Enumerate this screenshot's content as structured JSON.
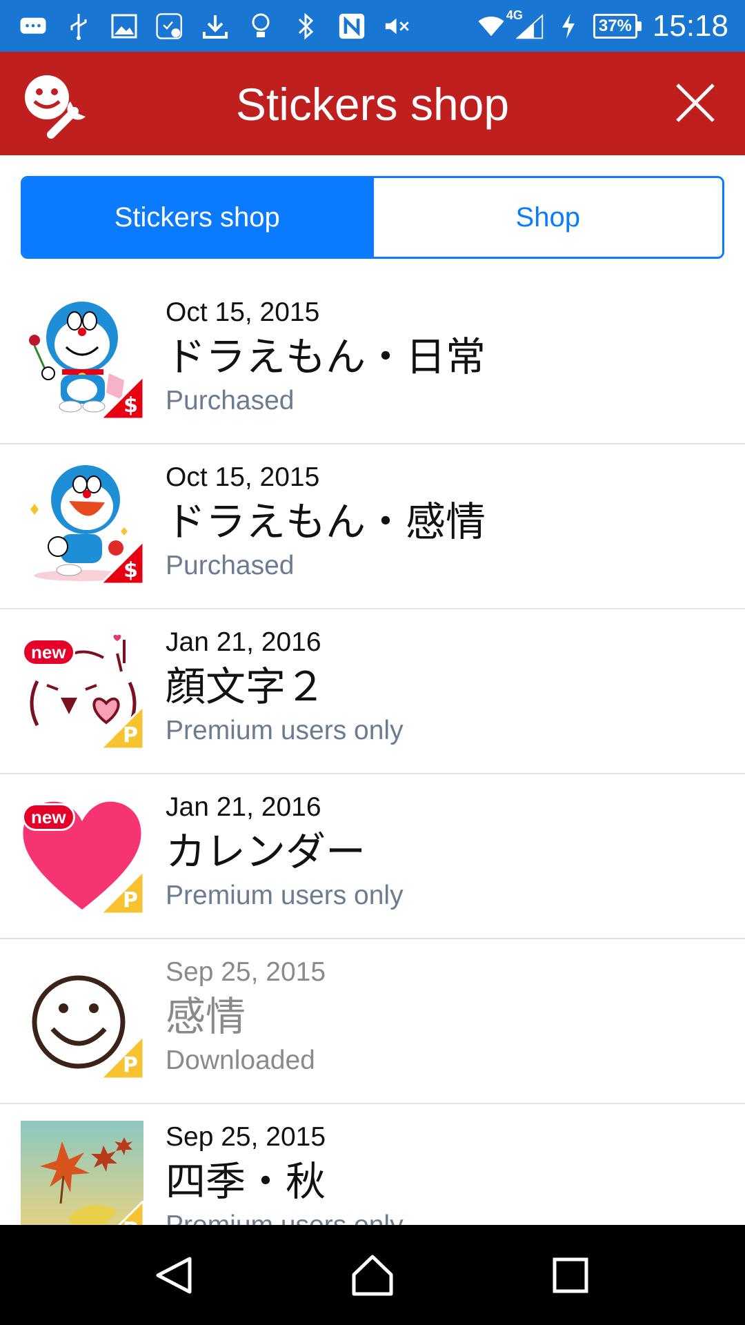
{
  "status_bar": {
    "time": "15:18",
    "battery": "37%",
    "network": "4G",
    "icons": [
      "chat-icon",
      "usb-icon",
      "image-icon",
      "app-check-icon",
      "download-icon",
      "bulb-icon",
      "bluetooth-icon",
      "nfc-icon",
      "mute-icon",
      "wifi-icon",
      "signal-icon",
      "charging-icon"
    ]
  },
  "header": {
    "title": "Stickers shop",
    "logo_icon": "smiley-wrench-icon",
    "close_icon": "close-icon",
    "color": "#bf1f1f"
  },
  "tabs": [
    {
      "label": "Stickers shop",
      "active": true
    },
    {
      "label": "Shop",
      "active": false
    }
  ],
  "items": [
    {
      "date": "Oct 15, 2015",
      "name": "ドラえもん・日常",
      "status": "Purchased",
      "badge": "$",
      "badge_type": "paid",
      "new": false,
      "thumb": "doraemon-daily"
    },
    {
      "date": "Oct 15, 2015",
      "name": "ドラえもん・感情",
      "status": "Purchased",
      "badge": "$",
      "badge_type": "paid",
      "new": false,
      "thumb": "doraemon-emotion"
    },
    {
      "date": "Jan 21, 2016",
      "name": "顔文字２",
      "status": "Premium users only",
      "badge": "P",
      "badge_type": "premium",
      "new": true,
      "new_label": "new",
      "thumb": "kaomoji"
    },
    {
      "date": "Jan 21, 2016",
      "name": "カレンダー",
      "status": "Premium users only",
      "badge": "P",
      "badge_type": "premium",
      "new": true,
      "new_label": "new",
      "thumb": "heart"
    },
    {
      "date": "Sep 25, 2015",
      "name": "感情",
      "status": "Downloaded",
      "badge": "P",
      "badge_type": "premium",
      "new": false,
      "thumb": "smiley"
    },
    {
      "date": "Sep 25, 2015",
      "name": "四季・秋",
      "status": "Premium users only",
      "badge": "P",
      "badge_type": "premium",
      "new": false,
      "thumb": "autumn"
    }
  ],
  "colors": {
    "status_bar": "#1976d2",
    "accent": "#0a7bff",
    "paid_badge": "#e60012",
    "premium_badge": "#f7c331",
    "new_badge": "#e5002a"
  },
  "nav": [
    "back-icon",
    "home-icon",
    "recents-icon"
  ]
}
